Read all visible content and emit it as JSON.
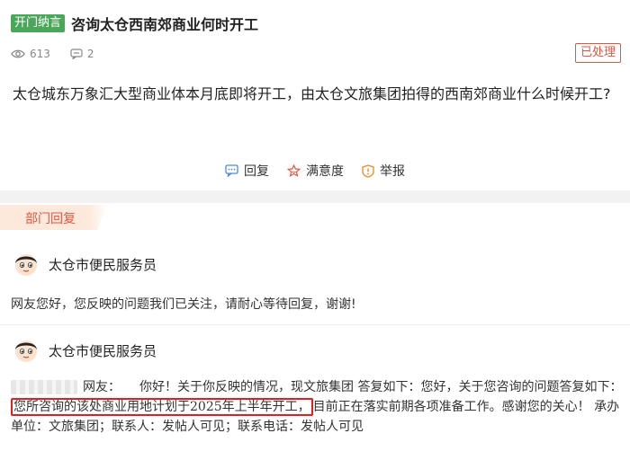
{
  "header": {
    "tag": "开门纳言",
    "title": "咨询太仓西南郊商业何时开工"
  },
  "meta": {
    "views": "613",
    "comments": "2"
  },
  "status": "已处理",
  "question": "太仓城东万象汇大型商业体本月底即将开工，由太仓文旅集团拍得的西南郊商业什么时候开工?",
  "actions": {
    "reply": "回复",
    "satisfaction": "满意度",
    "report": "举报"
  },
  "section_label": "部门回复",
  "replies": [
    {
      "author": "太仓市便民服务员",
      "text": "网友您好，您反映的问题我们已关注，请耐心等待回复，谢谢!"
    },
    {
      "author": "太仓市便民服务员",
      "part1": "网友：　　你好！关于你反映的情况，现文旅集团 答复如下：您好，关于您咨询的问题答复如下：",
      "highlight": "您所咨询的该处商业用地计划于2025年上半年开工，",
      "part2": "目前正在落实前期各项准备工作。感谢您的关心！ 承办单位：文旅集团；联系人：发帖人可见；联系电话：发帖人可见"
    }
  ],
  "colors": {
    "tag_green": "#4aa75a",
    "status_red": "#e3553f",
    "highlight_red": "#e02020"
  },
  "icons": [
    "eye-icon",
    "comment-icon",
    "reply-icon",
    "satisfaction-icon",
    "report-icon",
    "avatar"
  ]
}
